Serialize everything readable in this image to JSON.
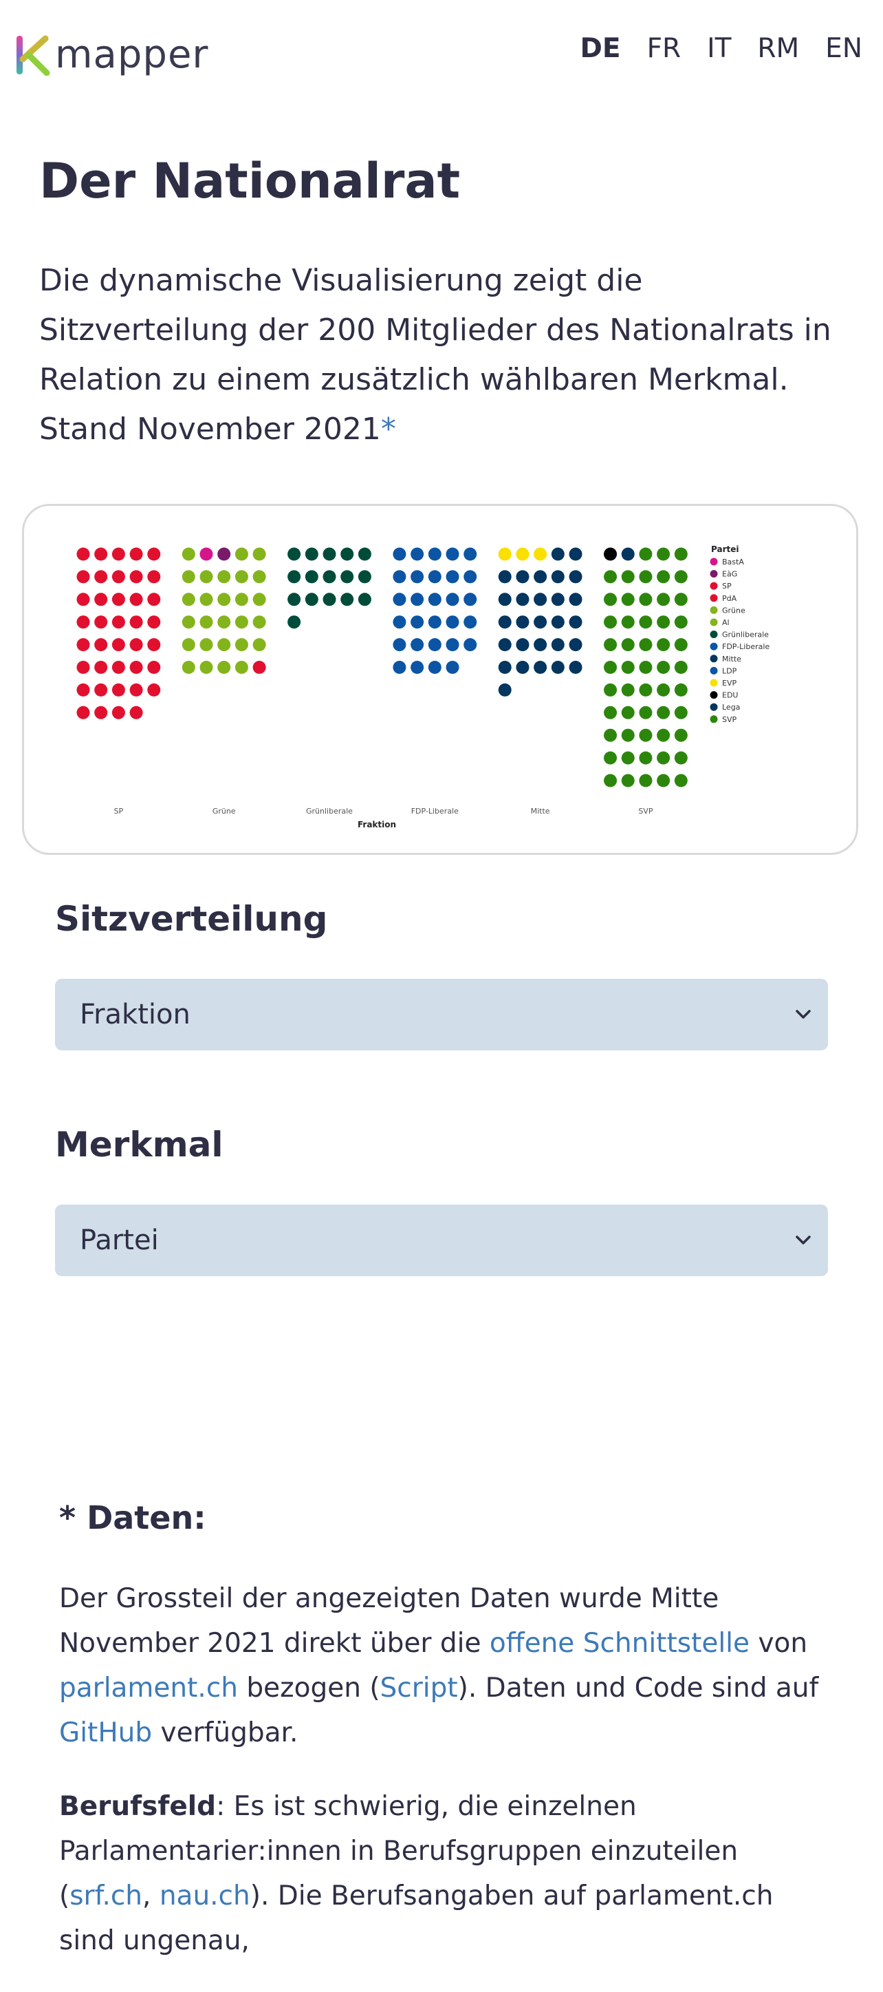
{
  "header": {
    "logo_text": "mapper",
    "languages": [
      "DE",
      "FR",
      "IT",
      "RM",
      "EN"
    ],
    "active_language": "DE"
  },
  "page": {
    "title": "Der Nationalrat",
    "intro": "Die dynamische Visualisierung zeigt die Sitzverteilung der 200 Mitglieder des Nationalrats in Relation zu einem zusätzlich wählbaren Merkmal. Stand November 2021",
    "intro_star": "*"
  },
  "chart_data": {
    "type": "scatter",
    "xlabel": "Fraktion",
    "legend_title": "Partei",
    "legend_position": "right",
    "categories": [
      "SP",
      "Grüne",
      "Grünliberale",
      "FDP-Liberale",
      "Mitte",
      "SVP"
    ],
    "parties": [
      {
        "name": "BastA",
        "color": "#d6158b"
      },
      {
        "name": "EàG",
        "color": "#7a1a6a"
      },
      {
        "name": "SP",
        "color": "#e2102f"
      },
      {
        "name": "PdA",
        "color": "#e2102f"
      },
      {
        "name": "Grüne",
        "color": "#84b41b"
      },
      {
        "name": "Al",
        "color": "#84b41b"
      },
      {
        "name": "Grünliberale",
        "color": "#004c3a"
      },
      {
        "name": "FDP-Liberale",
        "color": "#0b55a4"
      },
      {
        "name": "Mitte",
        "color": "#04365f"
      },
      {
        "name": "LDP",
        "color": "#0b55a4"
      },
      {
        "name": "EVP",
        "color": "#f9e000"
      },
      {
        "name": "EDU",
        "color": "#000000"
      },
      {
        "name": "Lega",
        "color": "#04365f"
      },
      {
        "name": "SVP",
        "color": "#2d860c"
      }
    ],
    "seats": [
      {
        "fraktion": "SP",
        "parties": [
          {
            "party": "SP",
            "count": 39
          }
        ]
      },
      {
        "fraktion": "Grüne",
        "parties": [
          {
            "party": "Grüne",
            "count": 1
          },
          {
            "party": "BastA",
            "count": 1
          },
          {
            "party": "EàG",
            "count": 1
          },
          {
            "party": "Grüne",
            "count": 26
          },
          {
            "party": "PdA",
            "count": 1
          }
        ]
      },
      {
        "fraktion": "Grünliberale",
        "parties": [
          {
            "party": "Grünliberale",
            "count": 16
          }
        ]
      },
      {
        "fraktion": "FDP-Liberale",
        "parties": [
          {
            "party": "FDP-Liberale",
            "count": 29
          }
        ]
      },
      {
        "fraktion": "Mitte",
        "parties": [
          {
            "party": "EVP",
            "count": 3
          },
          {
            "party": "Mitte",
            "count": 28
          }
        ]
      },
      {
        "fraktion": "SVP",
        "parties": [
          {
            "party": "EDU",
            "count": 1
          },
          {
            "party": "Lega",
            "count": 1
          },
          {
            "party": "SVP",
            "count": 53
          }
        ]
      }
    ]
  },
  "controls": {
    "distribution_label": "Sitzverteilung",
    "distribution_value": "Fraktion",
    "feature_label": "Merkmal",
    "feature_value": "Partei"
  },
  "notes": {
    "heading": "* Daten:",
    "p1_a": "Der Grossteil der angezeigten Daten wurde Mitte November 2021 direkt über die ",
    "p1_link1": "offene Schnittstelle",
    "p1_b": " von ",
    "p1_link2": "parlament.ch",
    "p1_c": " bezogen (",
    "p1_link3": "Script",
    "p1_d": "). Daten und Code sind auf ",
    "p1_link4": "GitHub",
    "p1_e": " verfügbar.",
    "p2_bold": "Berufsfeld",
    "p2_a": ": Es ist schwierig, die einzelnen Parlamentarier:innen in Berufsgruppen einzuteilen (",
    "p2_link1": "srf.ch",
    "p2_b": ", ",
    "p2_link2": "nau.ch",
    "p2_c": "). Die Berufsangaben auf parlament.ch sind ungenau,"
  }
}
